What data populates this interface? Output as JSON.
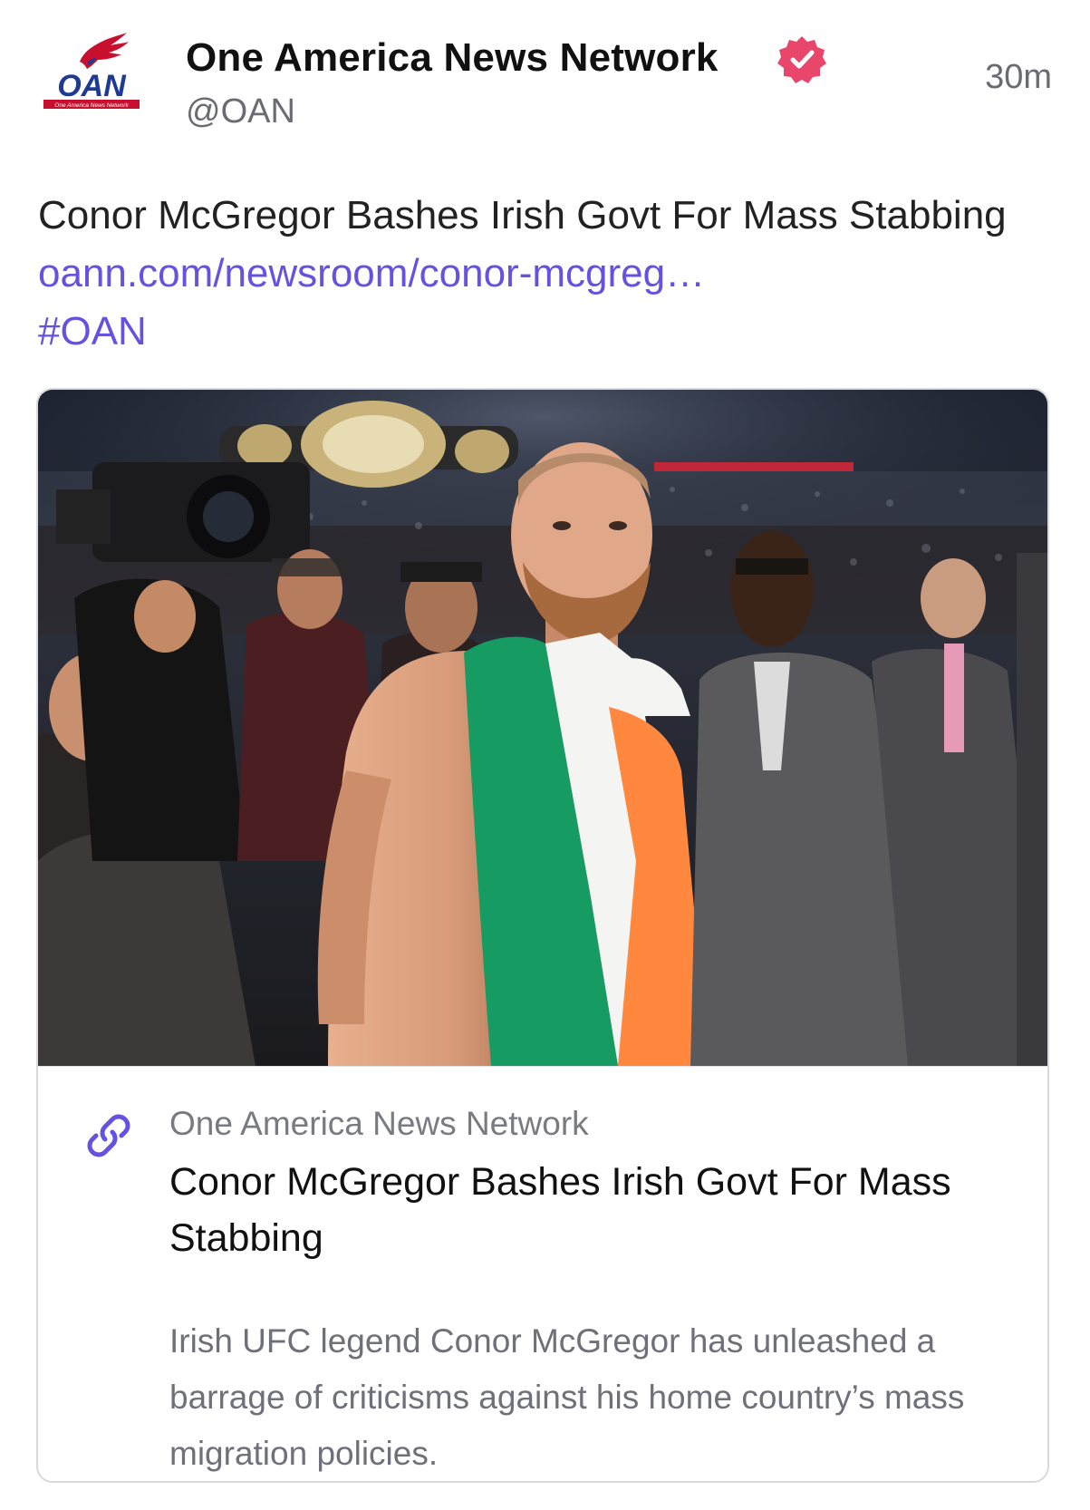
{
  "author": {
    "name": "One America News Network",
    "handle": "@OAN",
    "logo_text": "OAN",
    "logo_subtext": "One America News Network",
    "verified": true
  },
  "timestamp": "30m",
  "post": {
    "text": "Conor McGregor Bashes Irish Govt For Mass Stabbing",
    "link_text": "oann.com/newsroom/conor-mcgreg…",
    "hashtag": "#OAN"
  },
  "card": {
    "image_icon": "photo-mcgregor-irish-flag",
    "source": "One America News Network",
    "title": "Conor McGregor Bashes Irish Govt For Mass Stabbing",
    "description": "Irish UFC legend Conor McGregor has unleashed a barrage of criticisms against his home country’s mass migration policies."
  },
  "colors": {
    "accent": "#6552e0",
    "verified_badge": "#e8466a",
    "flag_green": "#169b62",
    "flag_white": "#ffffff",
    "flag_orange": "#ff883e",
    "logo_blue": "#1f3a93",
    "logo_red": "#c8102e"
  }
}
